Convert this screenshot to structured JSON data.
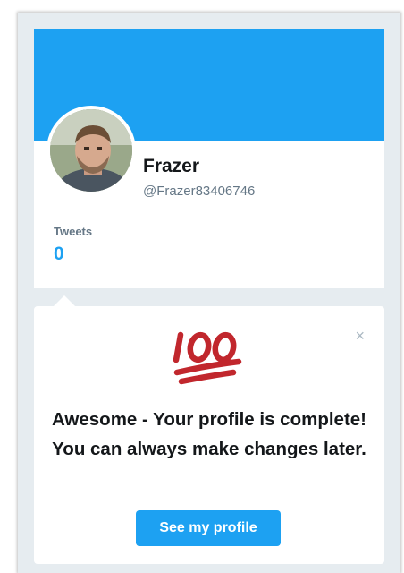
{
  "profile": {
    "name": "Frazer",
    "handle": "@Frazer83406746",
    "tweets_label": "Tweets",
    "tweets_count": "0",
    "banner_color": "#1da1f2"
  },
  "popover": {
    "icon": "hundred-points-emoji",
    "close_label": "×",
    "message": "Awesome - Your profile is complete! You can always make changes later.",
    "button_label": "See my profile"
  },
  "colors": {
    "accent": "#1da1f2",
    "emoji_red": "#c1272d",
    "page_bg": "#e6ecf0"
  }
}
